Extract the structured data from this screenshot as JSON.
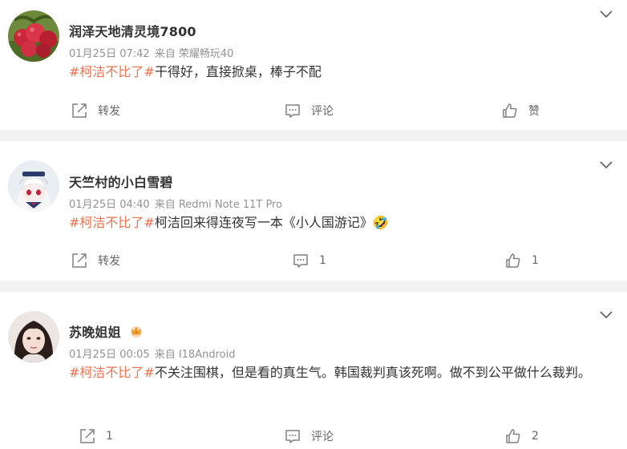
{
  "posts": [
    {
      "user": "润泽天地清灵境7800",
      "date": "01月25日 07:42",
      "source": "来自 荣耀畅玩40",
      "hashtag": "#柯洁不比了#",
      "text": "干得好，直接掀桌，棒子不配",
      "actions": {
        "repost": "转发",
        "comment": "评论",
        "like": "赞"
      }
    },
    {
      "user": "天竺村的小白雪碧",
      "date": "01月25日 04:40",
      "source": "来自 Redmi Note 11T Pro",
      "hashtag": "#柯洁不比了#",
      "text": "柯洁回来得连夜写一本《小人国游记》",
      "emoji": "🤣",
      "actions": {
        "repost": "转发",
        "comment": "1",
        "like": "1"
      }
    },
    {
      "user": "苏晚姐姐",
      "date": "01月25日 00:05",
      "source": "来自 I18Android",
      "hashtag": "#柯洁不比了#",
      "text": "不关注围棋，但是看的真生气。韩国裁判真该死啊。做不到公平做什么裁判。",
      "actions": {
        "repost": "1",
        "comment": "评论",
        "like": "2"
      }
    }
  ],
  "colors": {
    "hashtag": "#eb7350",
    "meta": "#939393",
    "separator": "#f2f2f2"
  }
}
